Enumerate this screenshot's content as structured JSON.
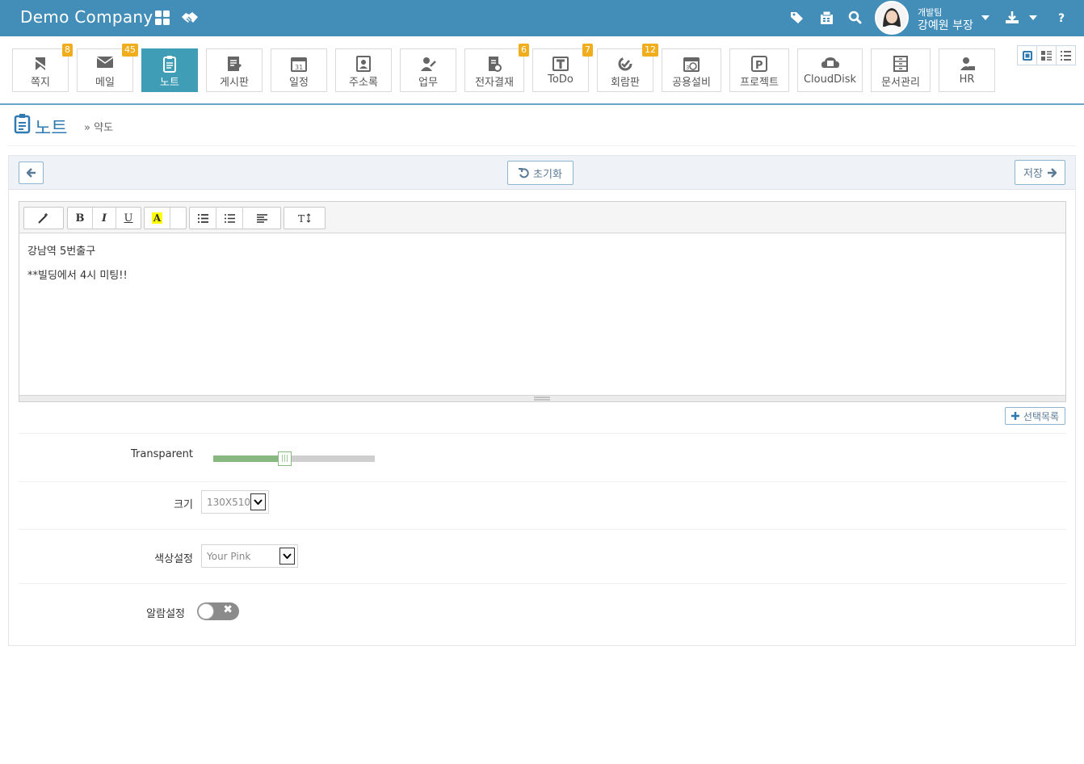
{
  "header": {
    "brand": "Demo Company",
    "user_team": "개발팀",
    "user_name": "강예원 부장"
  },
  "apps": [
    {
      "label": "쪽지",
      "badge": "8",
      "icon": "note-pin-icon"
    },
    {
      "label": "메일",
      "badge": "45",
      "icon": "mail-icon"
    },
    {
      "label": "노트",
      "badge": "",
      "icon": "clipboard-icon",
      "active": true
    },
    {
      "label": "게시판",
      "badge": "",
      "icon": "board-edit-icon"
    },
    {
      "label": "일정",
      "badge": "",
      "icon": "calendar-icon"
    },
    {
      "label": "주소록",
      "badge": "",
      "icon": "address-book-icon"
    },
    {
      "label": "업무",
      "badge": "",
      "icon": "task-icon"
    },
    {
      "label": "전자결재",
      "badge": "6",
      "icon": "approval-icon"
    },
    {
      "label": "ToDo",
      "badge": "7",
      "icon": "todo-icon"
    },
    {
      "label": "회람판",
      "badge": "12",
      "icon": "circular-icon"
    },
    {
      "label": "공용설비",
      "badge": "",
      "icon": "facility-icon"
    },
    {
      "label": "프로젝트",
      "badge": "",
      "icon": "project-icon"
    },
    {
      "label": "CloudDisk",
      "badge": "",
      "icon": "cloud-disk-icon"
    },
    {
      "label": "문서관리",
      "badge": "",
      "icon": "document-cabinet-icon"
    },
    {
      "label": "HR",
      "badge": "",
      "icon": "hr-icon"
    }
  ],
  "page": {
    "title": "노트",
    "crumb_sep": "»",
    "crumb": "약도"
  },
  "actions": {
    "reset": "초기화",
    "save": "저장",
    "select_list": "선택목록"
  },
  "editor": {
    "line1": "강남역 5번출구",
    "line2": "**빌딩에서 4시 미팅!!"
  },
  "form": {
    "transparent_label": "Transparent",
    "transparent_value": 0.44,
    "size_label": "크기",
    "size_value": "130X510",
    "color_label": "색상설정",
    "color_value": "Your Pink",
    "alarm_label": "알람설정",
    "alarm_on": false
  },
  "colors": {
    "topbar": "#438eb9",
    "active_app": "#3f9db6",
    "badge": "#f0ad1e",
    "slider": "#87b87f"
  }
}
